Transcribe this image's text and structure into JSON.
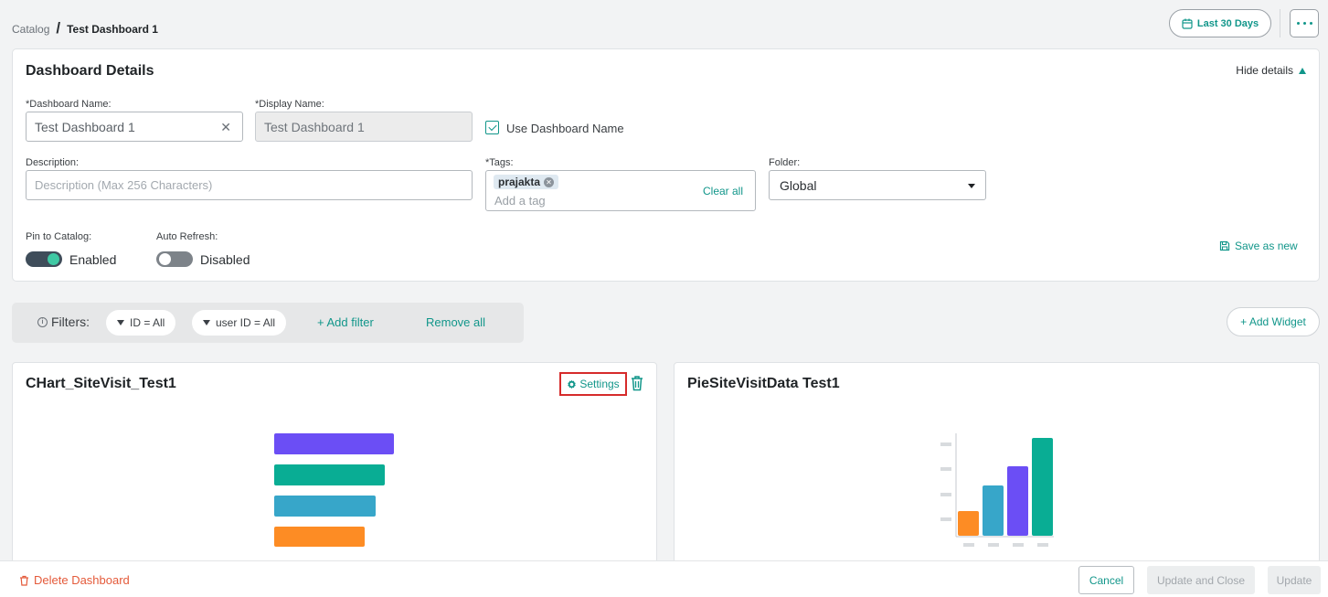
{
  "breadcrumb": {
    "parent": "Catalog",
    "separator": "/",
    "current": "Test Dashboard 1"
  },
  "header": {
    "date_range_label": "Last 30 Days",
    "more_label": "..."
  },
  "details": {
    "title": "Dashboard Details",
    "hide_label": "Hide details",
    "dashboard_name": {
      "label": "*Dashboard Name:",
      "value": "Test Dashboard 1"
    },
    "display_name": {
      "label": "*Display Name:",
      "value": "Test Dashboard 1"
    },
    "use_dashboard_name": {
      "label": "Use Dashboard Name",
      "checked": true
    },
    "description": {
      "label": "Description:",
      "placeholder": "Description (Max 256 Characters)"
    },
    "tags": {
      "label": "*Tags:",
      "items": [
        "prajakta"
      ],
      "placeholder": "Add a tag",
      "clear_label": "Clear all"
    },
    "folder": {
      "label": "Folder:",
      "value": "Global"
    },
    "pin_to_catalog": {
      "label": "Pin to Catalog:",
      "state": "Enabled",
      "on": true
    },
    "auto_refresh": {
      "label": "Auto Refresh:",
      "state": "Disabled",
      "on": false
    },
    "save_as_new": "Save as new"
  },
  "filters": {
    "label": "Filters:",
    "chips": [
      {
        "label": "ID = All"
      },
      {
        "label": "user ID = All"
      }
    ],
    "add_label": "+ Add filter",
    "remove_label": "Remove all"
  },
  "add_widget_label": "+ Add Widget",
  "widgets": [
    {
      "title": "CHart_SiteVisit_Test1",
      "settings_label": "Settings"
    },
    {
      "title": "PieSiteVisitData Test1"
    }
  ],
  "footer": {
    "delete_label": "Delete Dashboard",
    "cancel_label": "Cancel",
    "update_close_label": "Update and Close",
    "update_label": "Update"
  },
  "colors": {
    "accent": "#11968a",
    "purple": "#6b4ef5",
    "teal": "#09ad94",
    "cyan": "#37a6c9",
    "orange": "#fd8c24",
    "danger": "#e45a3a"
  }
}
